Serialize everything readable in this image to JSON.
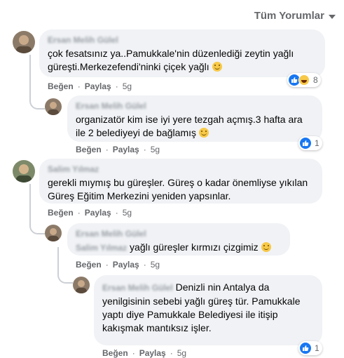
{
  "filter": {
    "label": "Tüm Yorumlar"
  },
  "comments": [
    {
      "author": "Ersan Melih Gülel",
      "text": "çok fesatsınız ya..Pamukkale'nin düzenlediği zeytin yağlı güreşti.Merkezefendi'ninki çiçek yağlı",
      "like": "Beğen",
      "reply": "Paylaş",
      "time": "5g",
      "reactions_count": "8"
    },
    {
      "author": "Ersan Melih Gülel",
      "text": "organizatör kim ise iyi yere tezgah açmış.3 hafta ara ile 2 belediyeyi de bağlamış",
      "like": "Beğen",
      "reply": "Paylaş",
      "time": "5g",
      "reactions_count": "1"
    },
    {
      "author": "Salim Yılmaz",
      "text": "gerekli mıymış bu güreşler. Güreş o kadar önemliyse yıkılan Güreş Eğitim Merkezini yeniden yapsınlar.",
      "like": "Beğen",
      "reply": "Paylaş",
      "time": "5g"
    },
    {
      "author": "Ersan Melih Gülel",
      "mention": "Salim Yılmaz",
      "text": "yağlı güreşler kırmızı çizgimiz",
      "like": "Beğen",
      "reply": "Paylaş",
      "time": "5g"
    },
    {
      "author": "Ersan Melih Gülel",
      "text": "Denizli nin Antalya da yenilgisinin sebebi yağlı güreş tür. Pamukkale yaptı diye Pamukkale Belediyesi ile itişip kakışmak mantıksız işler.",
      "like": "Beğen",
      "reply": "Paylaş",
      "time": "5g",
      "reactions_count": "1"
    }
  ]
}
